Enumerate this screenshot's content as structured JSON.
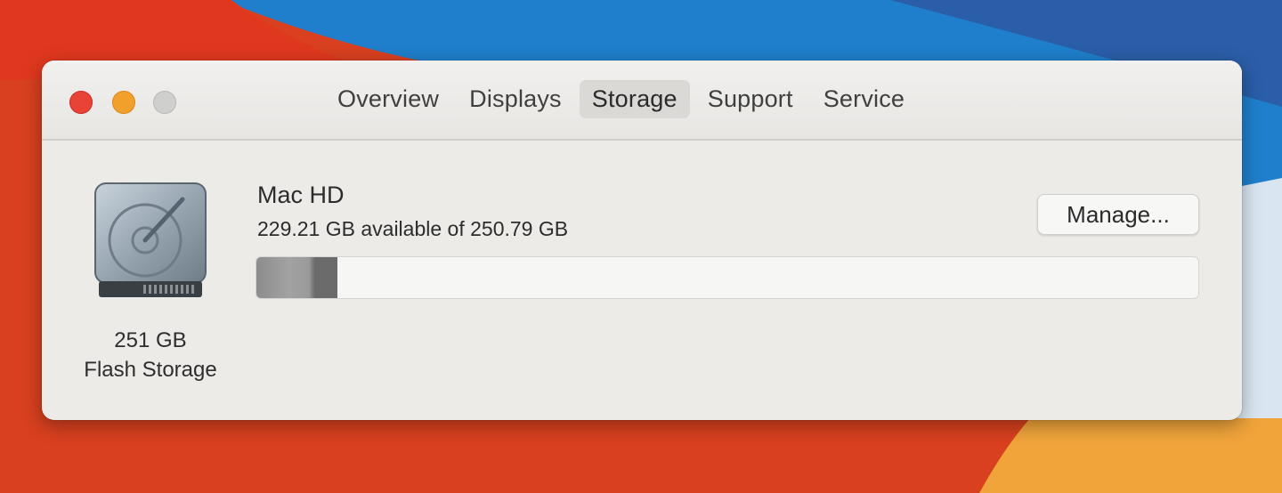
{
  "window": {
    "tabs": [
      {
        "label": "Overview"
      },
      {
        "label": "Displays"
      },
      {
        "label": "Storage",
        "active": true
      },
      {
        "label": "Support"
      },
      {
        "label": "Service"
      }
    ]
  },
  "drive": {
    "icon": "hard-drive-icon",
    "size_label": "251 GB",
    "type_label": "Flash Storage"
  },
  "volume": {
    "name": "Mac HD",
    "availability": "229.21 GB available of 250.79 GB",
    "used_fraction": 0.086,
    "manage_label": "Manage..."
  },
  "colors": {
    "close": "#e94237",
    "minimize": "#f1a02c",
    "zoom": "#cfcfcd",
    "window_bg": "#ecebe8"
  }
}
